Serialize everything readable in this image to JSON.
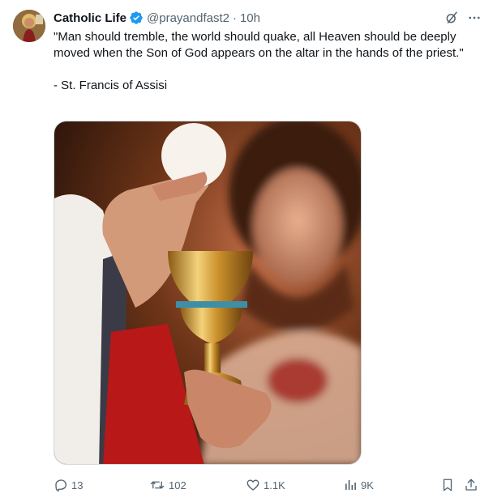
{
  "author": {
    "display_name": "Catholic Life",
    "handle": "@prayandfast2",
    "verified": true,
    "avatar_icon": "saint-portrait-avatar"
  },
  "meta": {
    "separator": "·",
    "time": "10h"
  },
  "header_icons": [
    "grok-icon",
    "more-icon"
  ],
  "tweet_text": "\"Man should tremble, the world should quake, all Heaven should be deeply moved when the Son of God appears on the altar in the hands of the priest.\"\n\n- St. Francis of Assisi",
  "media": {
    "description_icon": "eucharist-chalice-photo"
  },
  "actions": {
    "replies": "13",
    "reposts": "102",
    "likes": "1.1K",
    "views": "9K"
  },
  "colors": {
    "text": "#0f1419",
    "secondary": "#536471",
    "verified": "#1d9bf0",
    "border": "#cfd9de"
  }
}
